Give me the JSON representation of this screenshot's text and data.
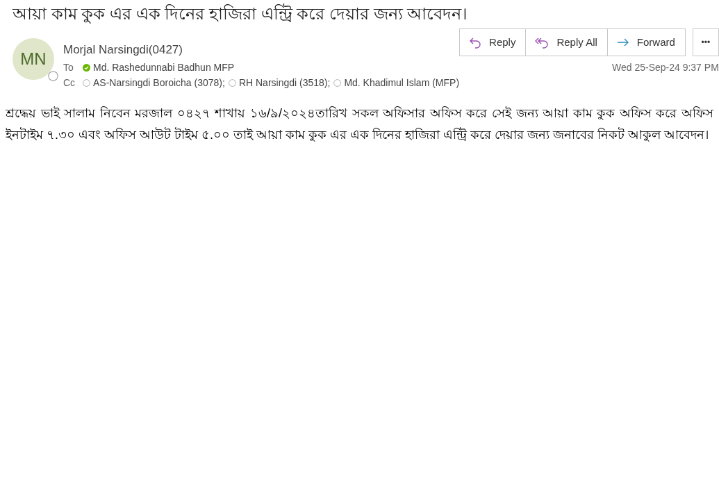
{
  "subject": "আয়া কাম কুক এর এক দিনের হাজিরা এন্ট্রি করে দেয়ার জন্য আবেদন।",
  "sender": {
    "initials": "MN",
    "name": "Morjal Narsingdi(0427)",
    "online": false
  },
  "to": {
    "label": "To",
    "recipients": [
      {
        "name": "Md. Rashedunnabi Badhun MFP",
        "online": true
      }
    ]
  },
  "cc": {
    "label": "Cc",
    "recipients": [
      {
        "name": "AS-Narsingdi Boroicha (3078);",
        "online": false
      },
      {
        "name": "RH Narsingdi (3518);",
        "online": false
      },
      {
        "name": "Md. Khadimul Islam (MFP)",
        "online": false
      }
    ]
  },
  "actions": [
    {
      "kind": "reply",
      "label": "Reply"
    },
    {
      "kind": "reply-all",
      "label": "Reply All"
    },
    {
      "kind": "forward",
      "label": "Forward"
    }
  ],
  "more_button": {
    "label": "•••"
  },
  "date": "Wed 25-Sep-24 9:37 PM",
  "body": "শ্রদ্ধেয় ভাই সালাম নিবেন মরজাল ০৪২৭ শাখায় ১৬/৯/২০২৪তারিখ সকল অফিসার অফিস করে সেই জন্য আয়া কাম কুক অফিস করে অফিস ইনটাইম ৭.৩০ এবং অফিস আউট টাইম ৫.০০ তাই আয়া কাম কুক এর এক দিনের হাজিরা এন্ট্রি করে দেয়ার জন্য জনাবের নিকট আকুল আবেদন।"
}
